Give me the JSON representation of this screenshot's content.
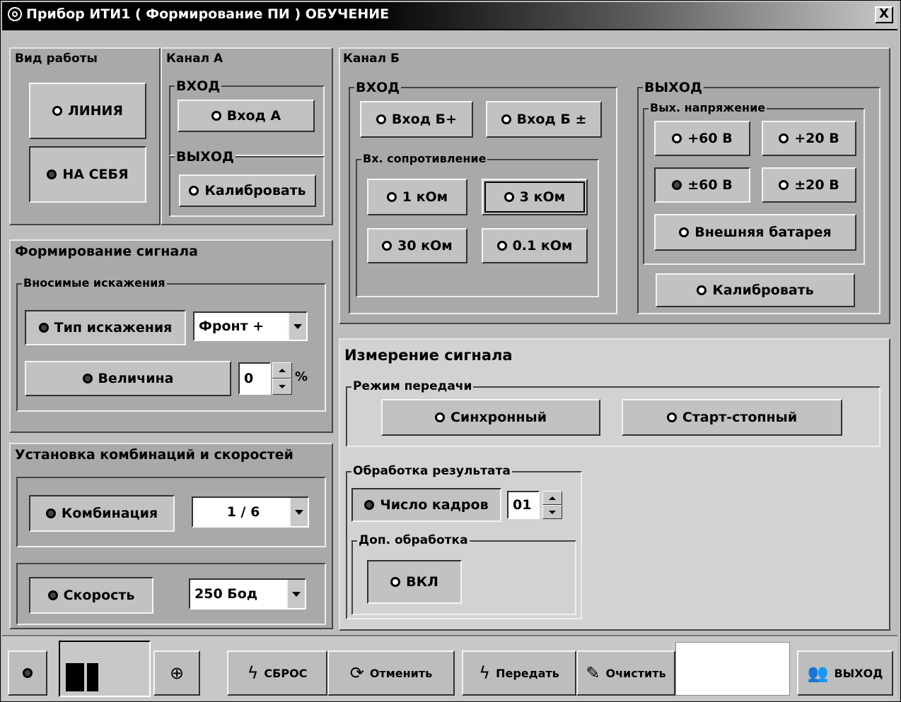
{
  "window": {
    "title": "Прибор ИТИ1 ( Формирование ПИ  ) ОБУЧЕНИЕ",
    "close_label": "X"
  },
  "vid_raboty": {
    "label": "Вид работы",
    "liniya": "ЛИНИЯ",
    "na_sebya": "НА СЕБЯ"
  },
  "kanal_a": {
    "label": "Канал А",
    "vhod_label": "ВХОД",
    "vhod_btn": "Вход А",
    "vyhod_label": "ВЫХОД",
    "kalibr_btn": "Калибровать"
  },
  "formirovanie": {
    "label": "Формирование сигнала",
    "iskazh_label": "Вносимые искажения",
    "tip_btn": "Тип искажения",
    "tip_value": "Фронт +",
    "velichina_btn": "Величина",
    "velichina_value": "0",
    "percent": "%"
  },
  "ustanovka": {
    "label": "Установка комбинаций и скоростей",
    "kombinaciya_btn": "Комбинация",
    "kombinaciya_value": "1 / 6",
    "skorost_btn": "Скорость",
    "skorost_value": "250 Бод"
  },
  "kanal_b": {
    "label": "Канал Б",
    "vhod_label": "ВХОД",
    "vhod_plus": "Вход Б+",
    "vhod_pm": "Вход Б ±",
    "sopr_label": "Вх. сопротивление",
    "r1": "1 кОм",
    "r3": "3 кОм",
    "r30": "30 кОм",
    "r01": "0.1 кОм",
    "vyhod_label": "ВЫХОД",
    "napr_label": "Вых. напряжение",
    "v60": "+60 В",
    "v20": "+20 В",
    "vpm60": "±60 В",
    "vpm20": "±20 В",
    "battery": "Внешняя батарея",
    "kalibr_btn": "Калибровать"
  },
  "izmerenie": {
    "label": "Измерение сигнала",
    "rezhim_label": "Режим передачи",
    "sync_btn": "Синхронный",
    "startstop_btn": "Старт-стопный",
    "obrabotka_label": "Обработка  результата",
    "kadry_btn": "Число кадров",
    "kadry_value": "01",
    "dop_label": "Доп. обработка",
    "vkl_btn": "ВКЛ"
  },
  "toolbar": {
    "sbros": "СБРОС",
    "otmenit": "Отменить",
    "peredat": "Передать",
    "ochistit": "Очистить",
    "vyhod": "ВЫХОД"
  }
}
